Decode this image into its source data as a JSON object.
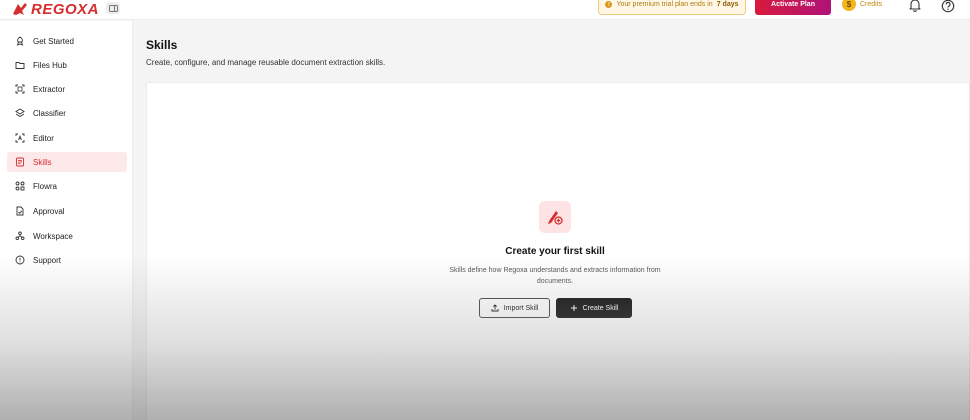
{
  "app": {
    "logo_text": "REGOXA",
    "brand_color": "#d42e2e"
  },
  "topbar": {
    "trial_prefix": "Your premium trial plan ends in",
    "trial_days": "7 days",
    "activate_label": "Activate Plan",
    "credits_symbol": "$",
    "credits_label": "Credits",
    "icons": [
      "sidebar-toggle-icon",
      "info-icon",
      "bell-icon",
      "help-icon"
    ]
  },
  "sidebar": {
    "items": [
      {
        "label": "Get Started",
        "icon": "rocket-icon"
      },
      {
        "label": "Files Hub",
        "icon": "folder-icon"
      },
      {
        "label": "Extractor",
        "icon": "scan-icon"
      },
      {
        "label": "Classifier",
        "icon": "layers-icon"
      },
      {
        "label": "Editor",
        "icon": "text-cursor-icon"
      },
      {
        "label": "Skills",
        "icon": "skills-icon",
        "active": true
      },
      {
        "label": "Flowra",
        "icon": "workflow-icon"
      },
      {
        "label": "Approval",
        "icon": "approval-icon"
      },
      {
        "label": "Workspace",
        "icon": "workspace-icon"
      },
      {
        "label": "Support",
        "icon": "support-icon"
      }
    ]
  },
  "main": {
    "title": "Skills",
    "subtitle": "Create, configure, and manage reusable document extraction skills."
  },
  "empty_state": {
    "icon": "skill-add-icon",
    "title": "Create your first skill",
    "description": "Skills define how Regoxa understands and extracts information from documents.",
    "import_label": "Import Skill",
    "create_label": "Create Skill"
  },
  "colors": {
    "active_bg": "#fde8ea",
    "accent": "#d42e2e",
    "trial_bg": "#fff7e6",
    "coin": "#f2b51c"
  }
}
